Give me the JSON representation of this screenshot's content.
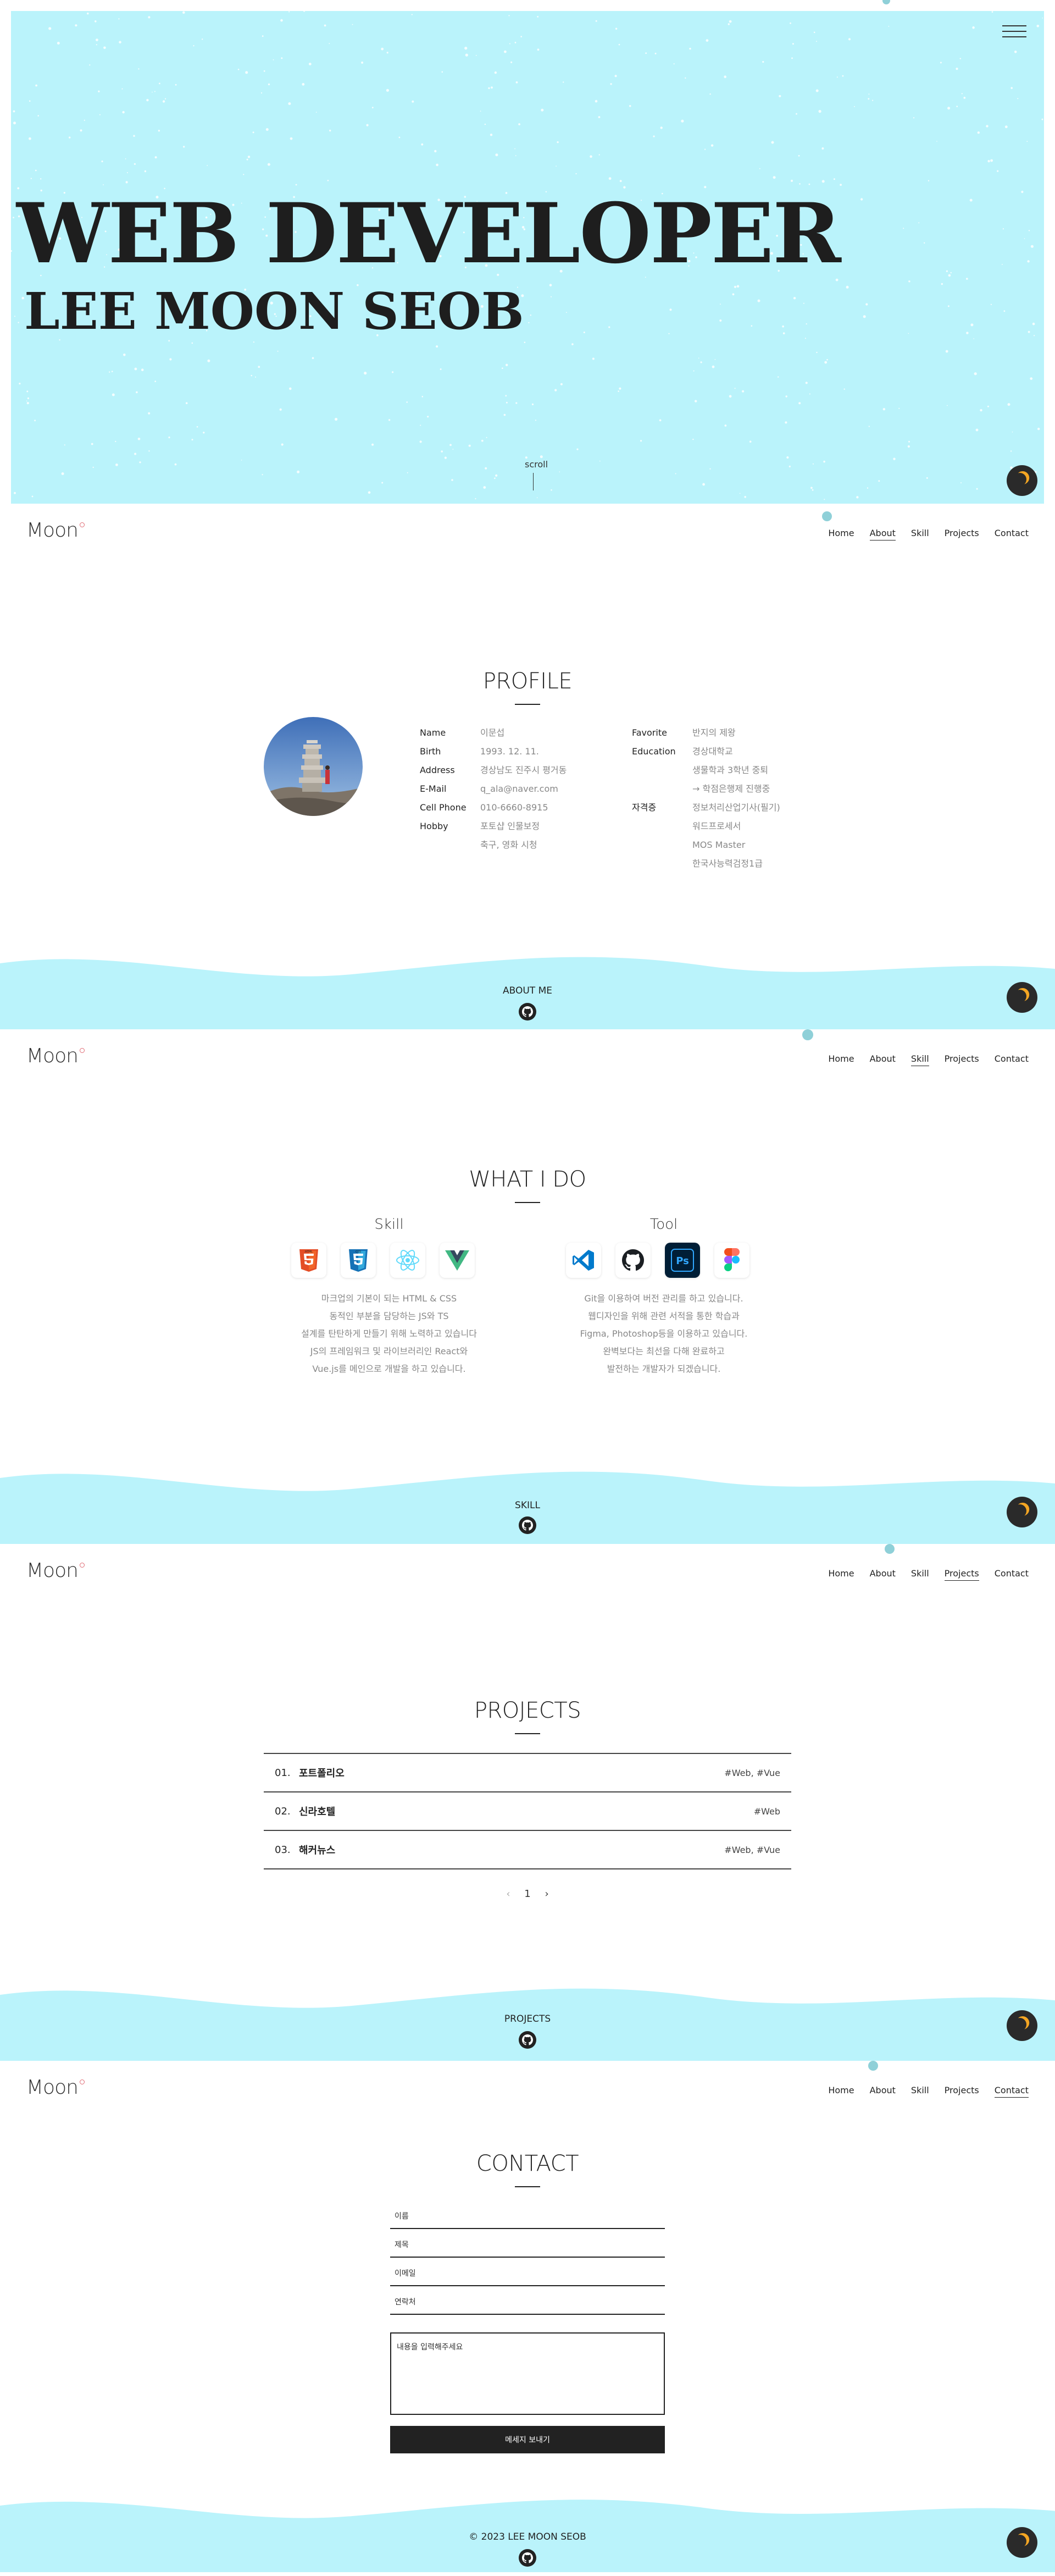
{
  "hero": {
    "title": "WEB DEVELOPER",
    "subtitle": "LEE MOON SEOB",
    "scroll_label": "scroll",
    "menu_icon": "hamburger-icon",
    "dark_mode_icon": "moon-icon"
  },
  "nav": {
    "logo": "Moon",
    "items": [
      "Home",
      "About",
      "Skill",
      "Projects",
      "Contact"
    ]
  },
  "profile": {
    "title": "PROFILE",
    "left": [
      {
        "key": "Name",
        "value": "이문섭"
      },
      {
        "key": "Birth",
        "value": "1993. 12. 11."
      },
      {
        "key": "Address",
        "value": "경상남도 진주시 평거동"
      },
      {
        "key": "E-Mail",
        "value": "q_ala@naver.com"
      },
      {
        "key": "Cell Phone",
        "value": "010-6660-8915"
      },
      {
        "key": "Hobby",
        "value": "포토샵 인물보정"
      },
      {
        "key": "",
        "value": "축구, 영화 시청"
      }
    ],
    "right": [
      {
        "key": "Favorite",
        "value": "반지의 제왕"
      },
      {
        "key": "Education",
        "value": "경상대학교"
      },
      {
        "key": "",
        "value": "생물학과 3학년 중퇴"
      },
      {
        "key": "",
        "value": "→ 학점은행제 진행중"
      },
      {
        "key": "자격증",
        "value": "정보처리산업기사(필기)"
      },
      {
        "key": "",
        "value": "워드프로세서"
      },
      {
        "key": "",
        "value": "MOS Master"
      },
      {
        "key": "",
        "value": "한국사능력검정1급"
      }
    ],
    "footer_label": "ABOUT ME"
  },
  "skill": {
    "title": "WHAT I DO",
    "skill_title": "Skill",
    "tool_title": "Tool",
    "skill_icons": [
      "html5-icon",
      "css3-icon",
      "react-icon",
      "vue-icon"
    ],
    "tool_icons": [
      "vscode-icon",
      "github-icon",
      "photoshop-icon",
      "figma-icon"
    ],
    "skill_desc": [
      "마크업의 기본이 되는 HTML & CSS",
      "동적인 부분을 담당하는 JS와 TS",
      "설계를 탄탄하게 만들기 위해 노력하고 있습니다",
      "JS의 프레임워크 및 라이브러리인 React와",
      "Vue.js를 메인으로 개발을 하고 있습니다."
    ],
    "tool_desc": [
      "Git을 이용하여 버전 관리를 하고 있습니다.",
      "웹디자인을 위해 관련 서적을 통한 학습과",
      "Figma, Photoshop등을 이용하고 있습니다.",
      "완벽보다는 최선을 다해 완료하고",
      "발전하는 개발자가 되겠습니다."
    ],
    "footer_label": "SKILL"
  },
  "projects": {
    "title": "PROJECTS",
    "rows": [
      {
        "num": "01.",
        "name": "포트폴리오",
        "tags": "#Web, #Vue"
      },
      {
        "num": "02.",
        "name": "신라호텔",
        "tags": "#Web"
      },
      {
        "num": "03.",
        "name": "해커뉴스",
        "tags": "#Web, #Vue"
      }
    ],
    "pager": {
      "prev": "‹",
      "page": "1",
      "next": "›"
    },
    "footer_label": "PROJECTS"
  },
  "contact": {
    "title": "CONTACT",
    "fields": {
      "name": "이름",
      "subject": "제목",
      "email": "이메일",
      "phone": "연락처"
    },
    "message_placeholder": "내용을 입력해주세요",
    "send_label": "메세지 보내기",
    "footer_label": "© 2023 LEE MOON SEOB"
  },
  "colors": {
    "accent": "#baf3fb",
    "bubble": "#8fd0d8",
    "dark": "#222222",
    "moon": "#f4a623"
  }
}
